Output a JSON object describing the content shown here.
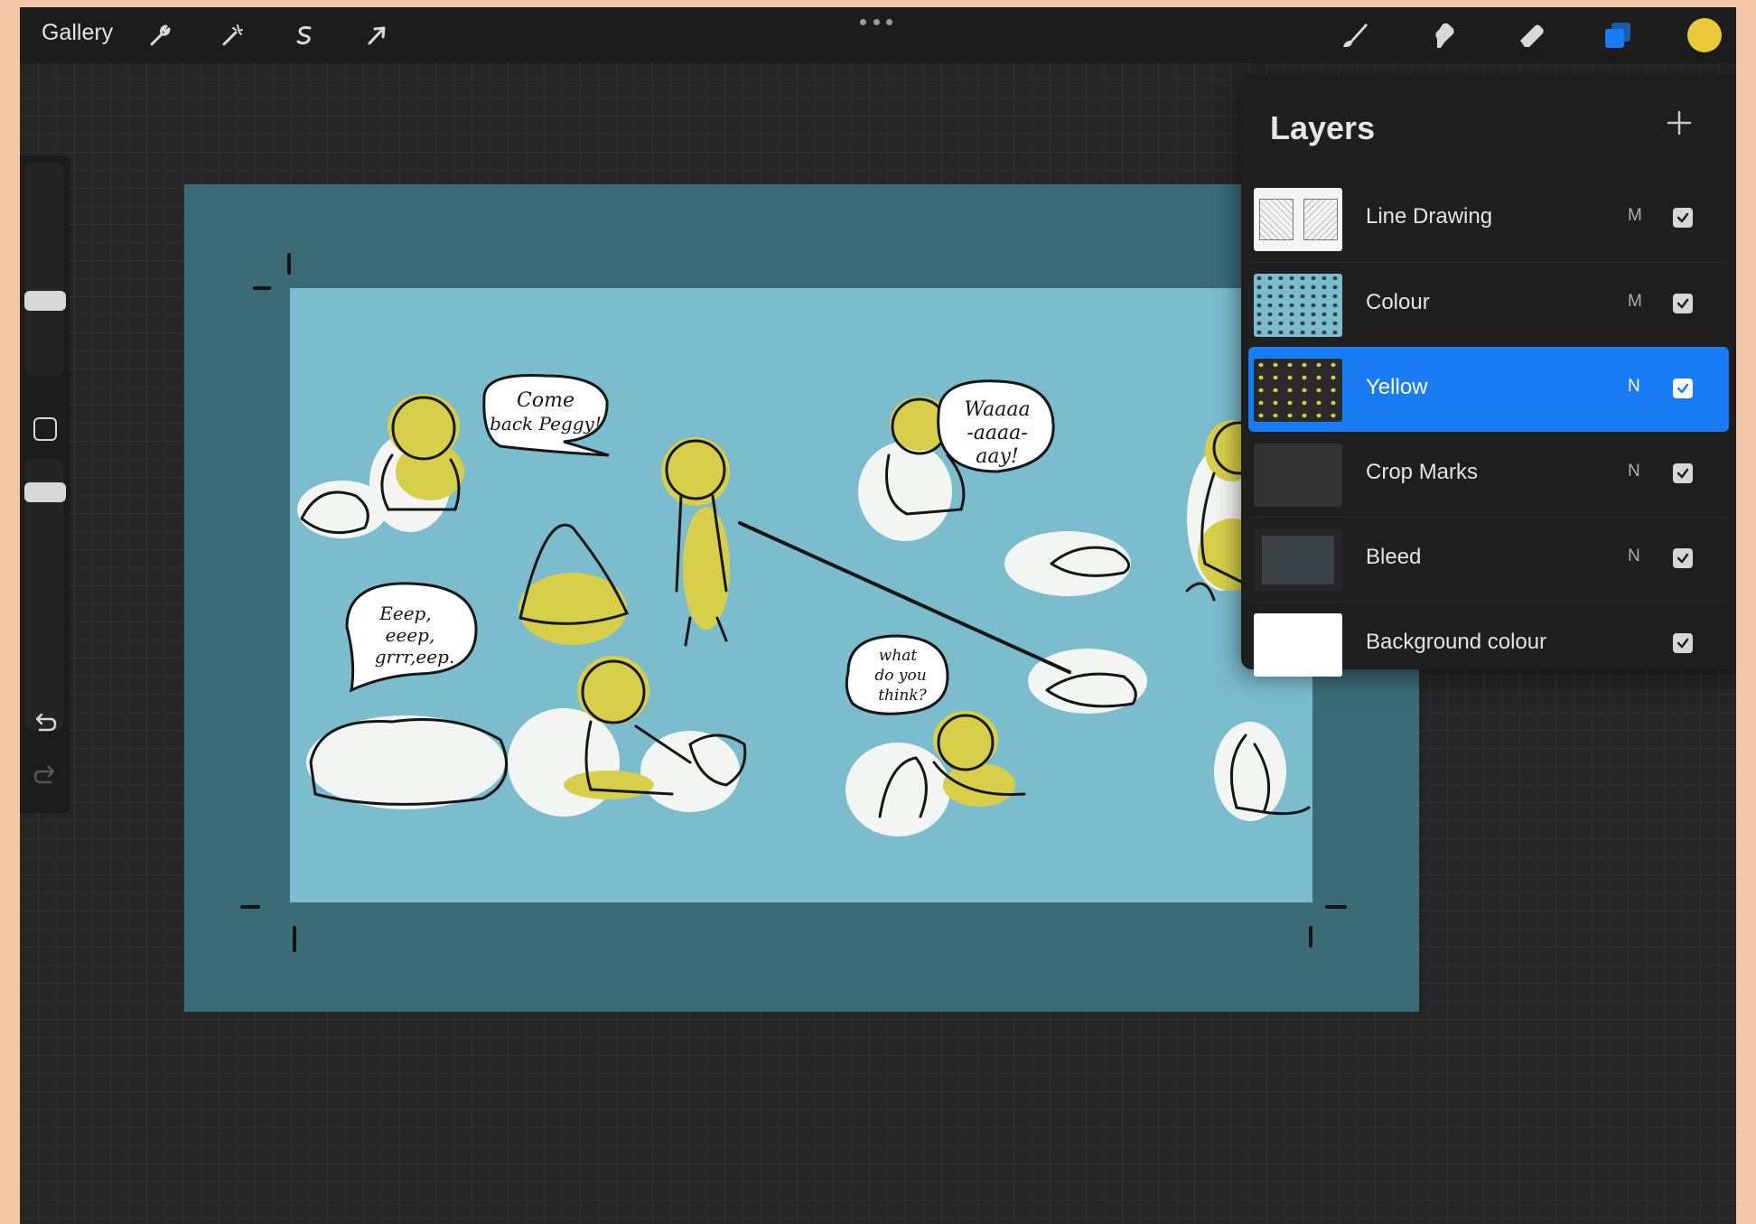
{
  "toolbar": {
    "gallery_label": "Gallery",
    "left_tools": [
      {
        "name": "actions-wrench-icon"
      },
      {
        "name": "adjustments-magic-wand-icon"
      },
      {
        "name": "selection-s-icon"
      },
      {
        "name": "transform-arrow-icon"
      }
    ],
    "right_tools": [
      {
        "name": "brush-icon"
      },
      {
        "name": "smudge-icon"
      },
      {
        "name": "eraser-icon"
      },
      {
        "name": "layers-icon"
      }
    ],
    "more_icon": "ellipsis-icon",
    "active_color": "#e9c93a",
    "layers_icon_color": "#1a7cf5"
  },
  "sidebar": {
    "brush_size_slider": "slider",
    "opacity_slider": "slider",
    "modify_button": "square-icon",
    "undo_icon": "undo-icon",
    "redo_icon": "redo-icon"
  },
  "canvas": {
    "bleed_color": "#3b6b75",
    "paper_color": "#7bbccd",
    "speech_bubbles": [
      {
        "id": "bubble-come-back",
        "text": [
          "Come",
          "back Peggy!"
        ]
      },
      {
        "id": "bubble-waaaa",
        "text": [
          "Waaaa",
          "-aaaa-",
          "aay!"
        ]
      },
      {
        "id": "bubble-eeep",
        "text": [
          "Eeep,",
          "eeep,",
          "grrr,eep."
        ]
      },
      {
        "id": "bubble-what",
        "text": [
          "what",
          "do you",
          "think?"
        ]
      }
    ]
  },
  "layers": {
    "title": "Layers",
    "add_icon": "plus-icon",
    "items": [
      {
        "name": "Line Drawing",
        "blend": "M",
        "visible": true,
        "selected": false,
        "thumb": "line"
      },
      {
        "name": "Colour",
        "blend": "M",
        "visible": true,
        "selected": false,
        "thumb": "colour"
      },
      {
        "name": "Yellow",
        "blend": "N",
        "visible": true,
        "selected": true,
        "thumb": "yellow"
      },
      {
        "name": "Crop Marks",
        "blend": "N",
        "visible": true,
        "selected": false,
        "thumb": "crop"
      },
      {
        "name": "Bleed",
        "blend": "N",
        "visible": true,
        "selected": false,
        "thumb": "bleed"
      },
      {
        "name": "Background colour",
        "blend": "",
        "visible": true,
        "selected": false,
        "thumb": "white"
      }
    ]
  }
}
